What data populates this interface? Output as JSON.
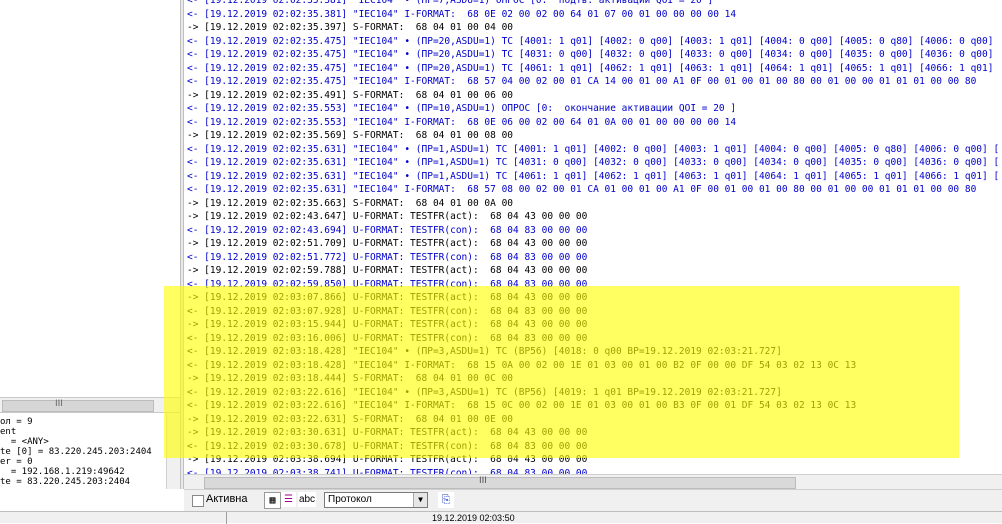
{
  "left_info": [
    "ол = 9",
    "ent",
    "  = <ANY>",
    "te [0] = 83.220.245.203:2404",
    "er = 0",
    "  = 192.168.1.219:49642",
    "te = 83.220.245.203:2404"
  ],
  "left_scroll_grip": "III",
  "log_lines": [
    {
      "dir": "in",
      "text": "<- [19.12.2019 02:02:35.381] \"IEC104\" • (ПР=7,ASDU=1) ОПРОС [0:  подтв. активации QOI = 20 ]"
    },
    {
      "dir": "in",
      "text": "<- [19.12.2019 02:02:35.381] \"IEC104\" I-FORMAT:  68 0E 02 00 02 00 64 01 07 00 01 00 00 00 00 14"
    },
    {
      "dir": "out",
      "text": "-> [19.12.2019 02:02:35.397] S-FORMAT:  68 04 01 00 04 00"
    },
    {
      "dir": "in",
      "text": "<- [19.12.2019 02:02:35.475] \"IEC104\" • (ПР=20,ASDU=1) TC [4001: 1 q01] [4002: 0 q00] [4003: 1 q01] [4004: 0 q00] [4005: 0 q80] [4006: 0 q00]"
    },
    {
      "dir": "in",
      "text": "<- [19.12.2019 02:02:35.475] \"IEC104\" • (ПР=20,ASDU=1) TC [4031: 0 q00] [4032: 0 q00] [4033: 0 q00] [4034: 0 q00] [4035: 0 q00] [4036: 0 q00]"
    },
    {
      "dir": "in",
      "text": "<- [19.12.2019 02:02:35.475] \"IEC104\" • (ПР=20,ASDU=1) TC [4061: 1 q01] [4062: 1 q01] [4063: 1 q01] [4064: 1 q01] [4065: 1 q01] [4066: 1 q01]"
    },
    {
      "dir": "in",
      "text": "<- [19.12.2019 02:02:35.475] \"IEC104\" I-FORMAT:  68 57 04 00 02 00 01 CA 14 00 01 00 A1 0F 00 01 00 01 00 80 00 01 00 00 01 01 01 00 00 80"
    },
    {
      "dir": "out",
      "text": "-> [19.12.2019 02:02:35.491] S-FORMAT:  68 04 01 00 06 00"
    },
    {
      "dir": "in",
      "text": "<- [19.12.2019 02:02:35.553] \"IEC104\" • (ПР=10,ASDU=1) ОПРОС [0:  окончание активации QOI = 20 ]"
    },
    {
      "dir": "in",
      "text": "<- [19.12.2019 02:02:35.553] \"IEC104\" I-FORMAT:  68 0E 06 00 02 00 64 01 0A 00 01 00 00 00 00 14"
    },
    {
      "dir": "out",
      "text": "-> [19.12.2019 02:02:35.569] S-FORMAT:  68 04 01 00 08 00"
    },
    {
      "dir": "in",
      "text": "<- [19.12.2019 02:02:35.631] \"IEC104\" • (ПР=1,ASDU=1) TC [4001: 1 q01] [4002: 0 q00] [4003: 1 q01] [4004: 0 q00] [4005: 0 q80] [4006: 0 q00] ["
    },
    {
      "dir": "in",
      "text": "<- [19.12.2019 02:02:35.631] \"IEC104\" • (ПР=1,ASDU=1) TC [4031: 0 q00] [4032: 0 q00] [4033: 0 q00] [4034: 0 q00] [4035: 0 q00] [4036: 0 q00] ["
    },
    {
      "dir": "in",
      "text": "<- [19.12.2019 02:02:35.631] \"IEC104\" • (ПР=1,ASDU=1) TC [4061: 1 q01] [4062: 1 q01] [4063: 1 q01] [4064: 1 q01] [4065: 1 q01] [4066: 1 q01] ["
    },
    {
      "dir": "in",
      "text": "<- [19.12.2019 02:02:35.631] \"IEC104\" I-FORMAT:  68 57 08 00 02 00 01 CA 01 00 01 00 A1 0F 00 01 00 01 00 80 00 01 00 00 01 01 01 00 00 80"
    },
    {
      "dir": "out",
      "text": "-> [19.12.2019 02:02:35.663] S-FORMAT:  68 04 01 00 0A 00"
    },
    {
      "dir": "out",
      "text": "-> [19.12.2019 02:02:43.647] U-FORMAT: TESTFR(act):  68 04 43 00 00 00"
    },
    {
      "dir": "in",
      "text": "<- [19.12.2019 02:02:43.694] U-FORMAT: TESTFR(con):  68 04 83 00 00 00"
    },
    {
      "dir": "out",
      "text": "-> [19.12.2019 02:02:51.709] U-FORMAT: TESTFR(act):  68 04 43 00 00 00"
    },
    {
      "dir": "in",
      "text": "<- [19.12.2019 02:02:51.772] U-FORMAT: TESTFR(con):  68 04 83 00 00 00"
    },
    {
      "dir": "out",
      "text": "-> [19.12.2019 02:02:59.788] U-FORMAT: TESTFR(act):  68 04 43 00 00 00"
    },
    {
      "dir": "in",
      "text": "<- [19.12.2019 02:02:59.850] U-FORMAT: TESTFR(con):  68 04 83 00 00 00"
    },
    {
      "dir": "out",
      "text": "-> [19.12.2019 02:03:07.866] U-FORMAT: TESTFR(act):  68 04 43 00 00 00"
    },
    {
      "dir": "out",
      "text": "<- [19.12.2019 02:03:07.928] U-FORMAT: TESTFR(con):  68 04 83 00 00 00"
    },
    {
      "dir": "out",
      "text": "-> [19.12.2019 02:03:15.944] U-FORMAT: TESTFR(act):  68 04 43 00 00 00"
    },
    {
      "dir": "out",
      "text": "<- [19.12.2019 02:03:16.006] U-FORMAT: TESTFR(con):  68 04 83 00 00 00"
    },
    {
      "dir": "out",
      "text": "<- [19.12.2019 02:03:18.428] \"IEC104\" • (ПР=3,ASDU=1) TC (BP56) [4018: 0 q00 BP=19.12.2019 02:03:21.727]"
    },
    {
      "dir": "out",
      "text": "<- [19.12.2019 02:03:18.428] \"IEC104\" I-FORMAT:  68 15 0A 00 02 00 1E 01 03 00 01 00 B2 0F 00 00 DF 54 03 02 13 0C 13"
    },
    {
      "dir": "out",
      "text": "-> [19.12.2019 02:03:18.444] S-FORMAT:  68 04 01 00 0C 00"
    },
    {
      "dir": "out",
      "text": "<- [19.12.2019 02:03:22.616] \"IEC104\" • (ПР=3,ASDU=1) TC (BP56) [4019: 1 q01 BP=19.12.2019 02:03:21.727]"
    },
    {
      "dir": "out",
      "text": "<- [19.12.2019 02:03:22.616] \"IEC104\" I-FORMAT:  68 15 0C 00 02 00 1E 01 03 00 01 00 B3 0F 00 01 DF 54 03 02 13 0C 13"
    },
    {
      "dir": "out",
      "text": "-> [19.12.2019 02:03:22.631] S-FORMAT:  68 04 01 00 0E 00"
    },
    {
      "dir": "out",
      "text": "-> [19.12.2019 02:03:30.631] U-FORMAT: TESTFR(act):  68 04 43 00 00 00"
    },
    {
      "dir": "out",
      "text": "<- [19.12.2019 02:03:30.678] U-FORMAT: TESTFR(con):  68 04 83 00 00 00"
    },
    {
      "dir": "out",
      "text": "-> [19.12.2019 02:03:38.694] U-FORMAT: TESTFR(act):  68 04 43 00 00 00"
    },
    {
      "dir": "in",
      "text": "<- [19.12.2019 02:03:38.741] U-FORMAT: TESTFR(con):  68 04 83 00 00 00"
    }
  ],
  "hscroll_grip": "III",
  "toolbar": {
    "active_label": "Активна",
    "protocol_value": "Протокол",
    "abc_label": "abc"
  },
  "icons": {
    "checkbox": "checkbox-icon",
    "grid": "grid-icon",
    "lines": "lines-icon",
    "abc": "abc-icon",
    "dropdown": "chevron-down-icon",
    "save": "save-icon"
  },
  "status": {
    "datetime": "19.12.2019 02:03:50"
  },
  "colors": {
    "incoming": "#0000cc",
    "outgoing": "#000000",
    "highlight": "#ffff00"
  }
}
